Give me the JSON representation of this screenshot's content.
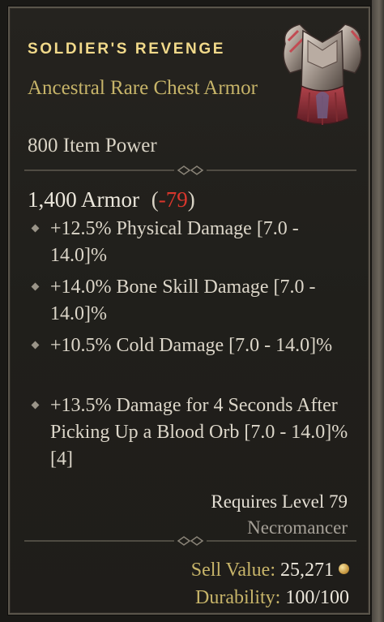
{
  "item": {
    "name": "SOLDIER'S REVENGE",
    "type": "Ancestral Rare Chest Armor",
    "power": "800 Item Power",
    "portrait_icon": "chest-armor-icon"
  },
  "armor": {
    "value": "1,400 Armor",
    "diff_open": "(",
    "diff": "-79",
    "diff_close": ")"
  },
  "affixes": [
    {
      "text": "+12.5% Physical Damage [7.0 - 14.0]%"
    },
    {
      "text": "+14.0% Bone Skill Damage [7.0 - 14.0]%"
    },
    {
      "text": "+10.5% Cold Damage [7.0 - 14.0]%"
    },
    {
      "text": "+13.5% Damage for 4 Seconds After Picking Up a Blood Orb [7.0 - 14.0]%[4]"
    }
  ],
  "requirements": {
    "level": "Requires Level 79",
    "class": "Necromancer"
  },
  "sell": {
    "label": "Sell Value:",
    "value": "25,271",
    "icon": "gold-coin-icon"
  },
  "durability": {
    "label": "Durability:",
    "value": "100/100"
  },
  "colors": {
    "rare_name": "#f1d98a",
    "rare_type": "#c7b469",
    "negative": "#d9362c",
    "text": "#dcd6c9"
  }
}
